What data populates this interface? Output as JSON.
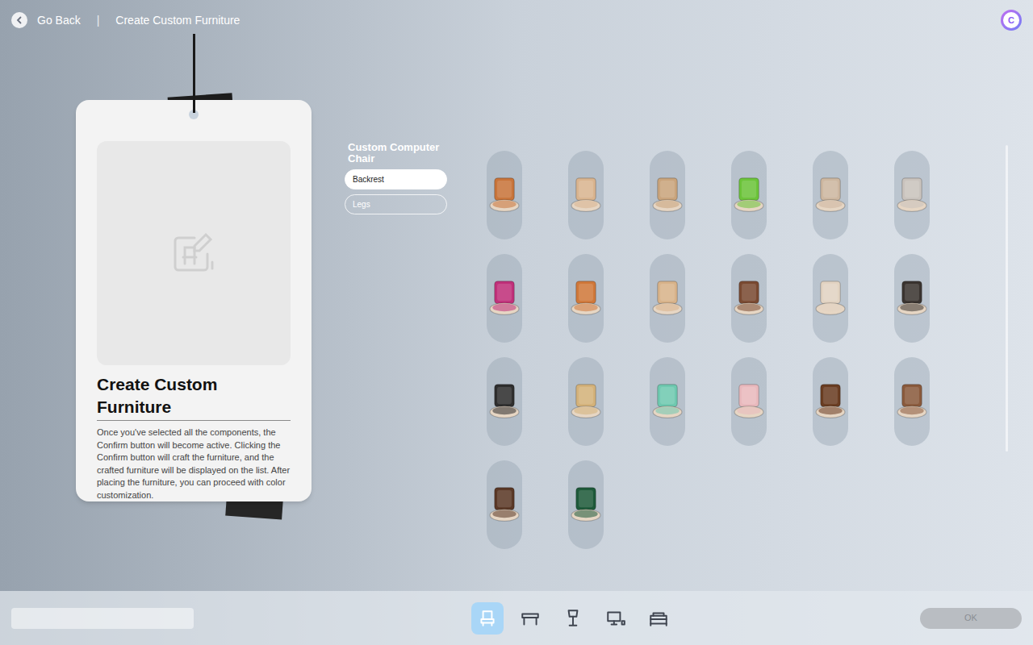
{
  "header": {
    "back_label": "Go Back",
    "separator": "|",
    "title": "Create Custom Furniture",
    "avatar": "C"
  },
  "info_card": {
    "title": "Create Custom Furniture",
    "description": "Once you've selected all the components, the Confirm button will become active. Clicking the Confirm button will craft the furniture, and the crafted furniture will be displayed on the list. After placing the furniture, you can proceed with color customization."
  },
  "part_panel": {
    "title": "Custom Computer Chair",
    "parts": [
      {
        "label": "Backrest",
        "selected": true
      },
      {
        "label": "Legs",
        "selected": false
      }
    ]
  },
  "backrests": [
    {
      "color": "#c8743a",
      "selected": false
    },
    {
      "color": "#d9b48f",
      "selected": false
    },
    {
      "color": "#c9a47c",
      "selected": false
    },
    {
      "color": "#6cc43a",
      "selected": false
    },
    {
      "color": "#cdb7a0",
      "selected": false
    },
    {
      "color": "#c9c3bd",
      "selected": false
    },
    {
      "color": "#c0307a",
      "selected": false
    },
    {
      "color": "#d0783a",
      "selected": false
    },
    {
      "color": "#d8b38a",
      "selected": false
    },
    {
      "color": "#7a4a32",
      "selected": false
    },
    {
      "color": "#e2d3c2",
      "selected": false
    },
    {
      "color": "#3a3430",
      "selected": false
    },
    {
      "color": "#2e2e2e",
      "selected": false
    },
    {
      "color": "#d4b27a",
      "selected": false
    },
    {
      "color": "#6fc9b0",
      "selected": false
    },
    {
      "color": "#e9b9bd",
      "selected": false
    },
    {
      "color": "#6a3d22",
      "selected": false
    },
    {
      "color": "#8a5a3c",
      "selected": false
    },
    {
      "color": "#5a3826",
      "selected": false
    },
    {
      "color": "#1e5a3a",
      "selected": false
    }
  ],
  "categories": [
    {
      "kind": "chair",
      "selected": true
    },
    {
      "kind": "table",
      "selected": false
    },
    {
      "kind": "lamp",
      "selected": false
    },
    {
      "kind": "computer",
      "selected": false
    },
    {
      "kind": "bed",
      "selected": false
    }
  ],
  "ok_button": {
    "label": "OK",
    "disabled": true
  }
}
